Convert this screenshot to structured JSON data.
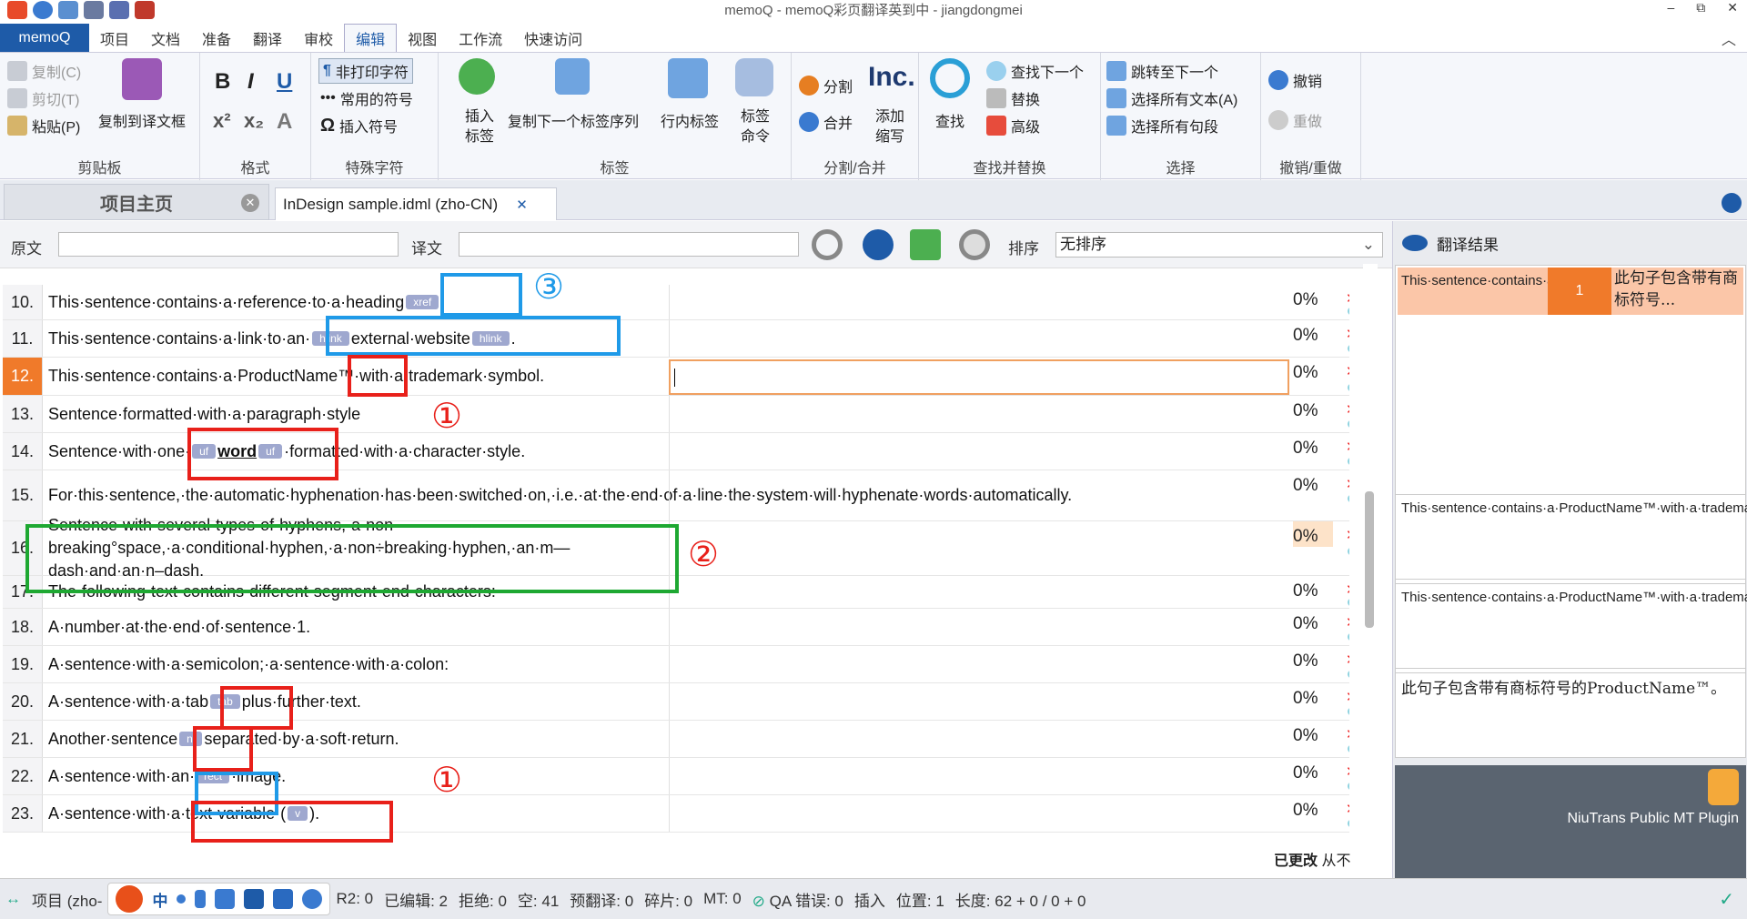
{
  "window": {
    "title": "memoQ - memoQ彩页翻译英到中 - jiangdongmei",
    "minimize": "–",
    "restore": "⧉",
    "close": "✕",
    "collapse": "︿"
  },
  "menu": {
    "memoq": "memoQ",
    "tabs": [
      "项目",
      "文档",
      "准备",
      "翻译",
      "审校",
      "编辑",
      "视图",
      "工作流",
      "快速访问"
    ]
  },
  "ribbon": {
    "clipboard": {
      "copy": "复制(C)",
      "cut": "剪切(T)",
      "paste": "粘贴(P)",
      "copy_to_target": "复制到译文框",
      "label": "剪贴板"
    },
    "format": {
      "bold": "B",
      "italic": "I",
      "underline": "U",
      "superscript": "x²",
      "subscript": "x₂",
      "clear": "A",
      "label": "格式"
    },
    "special": {
      "nonprinting": "非打印字符",
      "common": "常用的符号",
      "insert": "插入符号",
      "label": "特殊字符"
    },
    "tags": {
      "insert": "插入标签",
      "copy_next": "复制下一个标签序列",
      "inline": "行内标签",
      "commands": "标签命令",
      "label": "标签"
    },
    "split": {
      "split": "分割",
      "merge": "合并",
      "add_abbr": "添加缩写",
      "abbr_icon": "Inc.",
      "label": "分割/合并"
    },
    "find": {
      "find": "查找",
      "find_next": "查找下一个",
      "replace": "替换",
      "advanced": "高级",
      "label": "查找并替换"
    },
    "select": {
      "goto_next": "跳转至下一个",
      "select_all_text": "选择所有文本(A)",
      "select_all_seg": "选择所有句段",
      "label": "选择"
    },
    "undo": {
      "undo": "撤销",
      "redo": "重做",
      "label": "撤销/重做"
    }
  },
  "tabs": {
    "home": "项目主页",
    "home_close": "✕",
    "doc": "InDesign sample.idml (zho-CN)",
    "doc_close": "✕"
  },
  "filter": {
    "source_label": "原文",
    "target_label": "译文",
    "sort_label": "排序",
    "sort_value": "无排序"
  },
  "segments": [
    {
      "n": "10.",
      "pre": "This·sentence·contains·a·reference·to·a·heading",
      "tag": "xref",
      "post": ".",
      "pct": "0%"
    },
    {
      "n": "11.",
      "pre": "This·sentence·contains·a·link·to·an·",
      "tag": "hlink",
      "mid": "external·website",
      "tag2": "hlink",
      "post": ".",
      "pct": "0%"
    },
    {
      "n": "12.",
      "pre": "This·sentence·contains·a·ProductName™·with·a·trademark·symbol.",
      "pct": "0%"
    },
    {
      "n": "13.",
      "pre": "Sentence·formatted·with·a·paragraph·style",
      "pct": "0%"
    },
    {
      "n": "14.",
      "pre": "Sentence·with·one·",
      "tag": "uf",
      "mid": "word",
      "tag2": "uf",
      "post": "·formatted·with·a·character·style.",
      "pct": "0%"
    },
    {
      "n": "15.",
      "pre": "For·this·sentence,·the·automatic·hyphenation·has·been·switched·on,·i.e.·at·the·end·of·a·line·the·system·will·hyphenate·words·automatically.",
      "pct": "0%"
    },
    {
      "n": "16.",
      "pre": "Sentence·with·several·types·of·hyphens,·a·non-breaking°space,·a·conditional·hyphen,·a·non÷breaking·hyphen,·an·m—dash·and·an·n–dash.",
      "pct": "0%"
    },
    {
      "n": "17.",
      "pre": "The·following·text·contains·different·segment·end·characters:",
      "pct": "0%"
    },
    {
      "n": "18.",
      "pre": "A·number·at·the·end·of·sentence·1.",
      "pct": "0%"
    },
    {
      "n": "19.",
      "pre": "A·sentence·with·a·semicolon;·a·sentence·with·a·colon:",
      "pct": "0%"
    },
    {
      "n": "20.",
      "pre": "A·sentence·with·a·tab",
      "tag": "tab",
      "post": "plus·further·text.",
      "pct": "0%"
    },
    {
      "n": "21.",
      "pre": "Another·sentence",
      "tag": "nl",
      "post": "separated·by·a·soft·return.",
      "pct": "0%"
    },
    {
      "n": "22.",
      "pre": "A·sentence·with·an·",
      "tag": "rect",
      "post": "·image.",
      "pct": "0%"
    },
    {
      "n": "23.",
      "pre": "A·sentence·with·a·text·variable·(",
      "tag": "v",
      "post": ").",
      "pct": "0%"
    }
  ],
  "annotations": [
    "①",
    "②",
    "③",
    "①"
  ],
  "changed_label": "已更改",
  "changed_from": "从不",
  "results": {
    "title": "翻译结果",
    "hit_source": "This·sentence·contains·a·Pr...",
    "hit_number": "1",
    "hit_target": "此句子包含带有商标符号...",
    "compare1": "This·sentence·contains·a·ProductName™·with·a·trademark·symbol.",
    "compare2": "This·sentence·contains·a·ProductName™·with·a·trademark·symbol.",
    "translation": "此句子包含带有商标符号的ProductName™。",
    "mt_plugin": "NiuTrans Public MT Plugin"
  },
  "status": {
    "project": "项目 (zho-",
    "ime": "中",
    "r2": "R2: 0",
    "edited": "已编辑: 2",
    "rejected": "拒绝: 0",
    "empty": "空: 41",
    "pretrans": "预翻译: 0",
    "fragments": "碎片: 0",
    "mt": "MT: 0",
    "qa": "QA 错误:  0",
    "insert": "插入",
    "position": "位置:  1",
    "length": "长度:  62 + 0 / 0 + 0"
  },
  "colors": {
    "accent": "#1e5ba8",
    "active_row": "#f07a2a",
    "red_box": "#e8201a",
    "blue_box": "#1f9ae8",
    "green_box": "#1ea832"
  }
}
